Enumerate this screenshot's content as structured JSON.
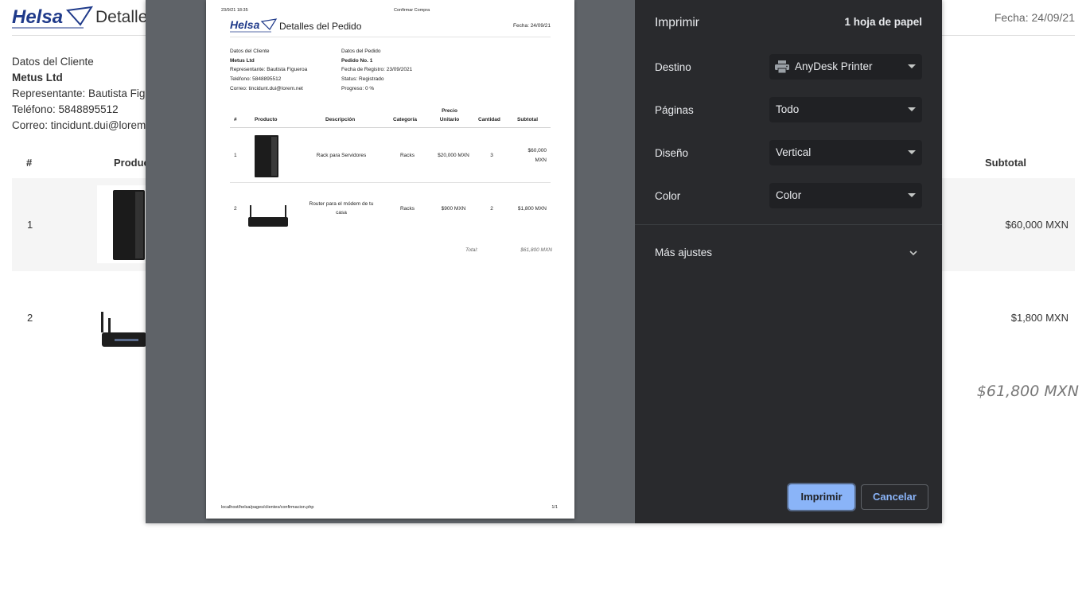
{
  "background": {
    "logo_text": "Helsa",
    "title": "Detalle",
    "date": "Fecha: 24/09/21",
    "customer": {
      "heading": "Datos del Cliente",
      "name": "Metus Ltd",
      "rep": "Representante: Bautista Figu",
      "phone": "Teléfono: 5848895512",
      "email": "Correo: tincidunt.dui@lorem"
    },
    "table": {
      "col_num": "#",
      "col_product": "Produc",
      "col_subtotal": "Subtotal",
      "rows": [
        {
          "num": "1",
          "subtotal": "$60,000 MXN"
        },
        {
          "num": "2",
          "subtotal": "$1,800 MXN"
        }
      ]
    },
    "total": "$61,800 MXN"
  },
  "preview": {
    "header_datetime": "23/9/21 18:35",
    "header_page_title": "Confirmar Compra",
    "logo_text": "Helsa",
    "title": "Detalles del Pedido",
    "date": "Fecha: 24/09/21",
    "customer": {
      "heading": "Datos del Cliente",
      "name": "Metus Ltd",
      "rep": "Representante: Bautista Figueroa",
      "phone": "Teléfono: 5848895512",
      "email": "Correo: tincidunt.dui@lorem.net"
    },
    "order": {
      "heading": "Datos del Pedido",
      "number": "Pedido No. 1",
      "registered": "Fecha de Registro: 23/09/2021",
      "status": "Status: Registrado",
      "progress": "Progreso: 0 %"
    },
    "columns": {
      "num": "#",
      "product": "Producto",
      "description": "Descripción",
      "category": "Categoría",
      "price_l1": "Precio",
      "price_l2": "Unitario",
      "qty": "Cantidad",
      "subtotal": "Subtotal"
    },
    "rows": [
      {
        "num": "1",
        "description": "Rack para Servidores",
        "category": "Racks",
        "price": "$20,000 MXN",
        "qty": "3",
        "subtotal_l1": "$60,000",
        "subtotal_l2": "MXN"
      },
      {
        "num": "2",
        "description_l1": "Router para el módem de tu",
        "description_l2": "casa",
        "category": "Racks",
        "price": "$900 MXN",
        "qty": "2",
        "subtotal": "$1,800 MXN"
      }
    ],
    "total_label": "Total:",
    "total_value": "$61,800 MXN",
    "footer_url": "localhost/helsa/pages/clientes/confirmacion.php",
    "footer_page": "1/1"
  },
  "settings": {
    "title": "Imprimir",
    "sheets": "1 hoja de papel",
    "destination_label": "Destino",
    "destination_value": "AnyDesk Printer",
    "pages_label": "Páginas",
    "pages_value": "Todo",
    "layout_label": "Diseño",
    "layout_value": "Vertical",
    "color_label": "Color",
    "color_value": "Color",
    "more_settings": "Más ajustes",
    "print_button": "Imprimir",
    "cancel_button": "Cancelar"
  },
  "colors": {
    "dialog_bg": "#292a2d",
    "preview_bg": "#5f6368",
    "accent": "#8ab4f8",
    "logo_blue": "#1f3a8a"
  }
}
